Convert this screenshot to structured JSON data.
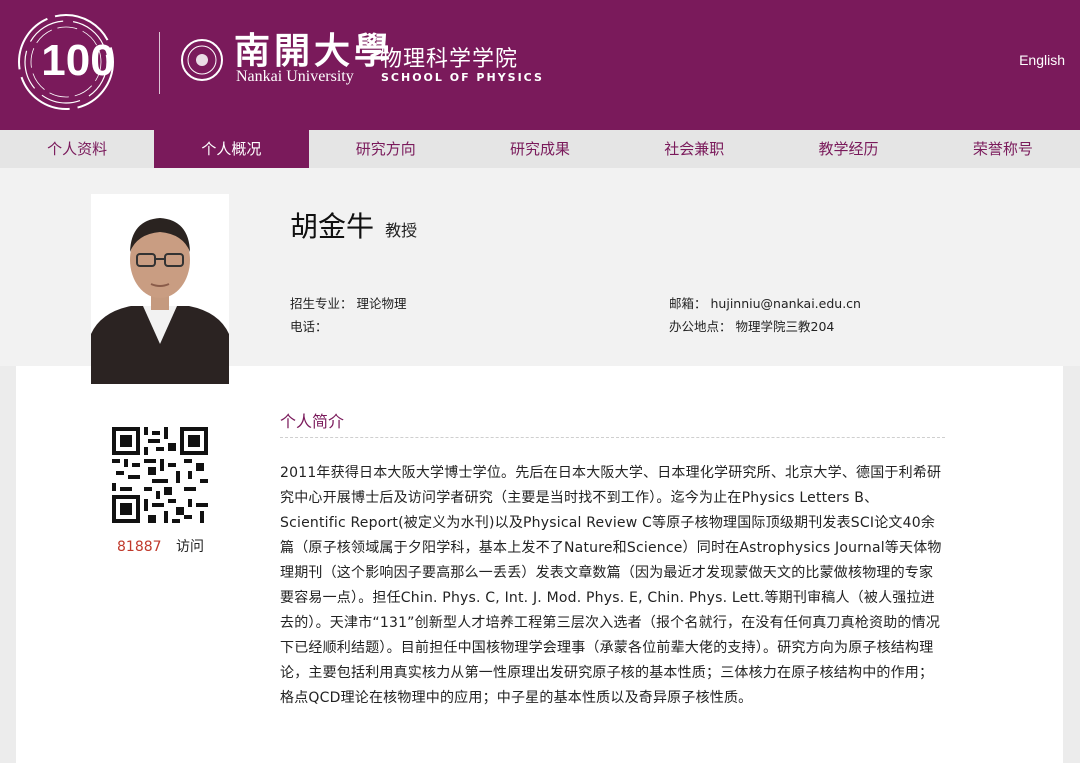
{
  "header": {
    "logo_number": "100",
    "university_cn": "南開大學",
    "university_en": "Nankai University",
    "school_cn": "物理科学学院",
    "school_en": "SCHOOL OF PHYSICS",
    "language_link": "English",
    "brand_color": "#7a1a5b"
  },
  "nav": {
    "items": [
      {
        "label": "个人资料",
        "active": false
      },
      {
        "label": "个人概况",
        "active": true
      },
      {
        "label": "研究方向",
        "active": false
      },
      {
        "label": "研究成果",
        "active": false
      },
      {
        "label": "社会兼职",
        "active": false
      },
      {
        "label": "教学经历",
        "active": false
      },
      {
        "label": "荣誉称号",
        "active": false
      }
    ]
  },
  "profile": {
    "name": "胡金牛",
    "title": "教授",
    "major_label": "招生专业：",
    "major_value": "理论物理",
    "phone_label": "电话：",
    "phone_value": "",
    "email_label": "邮箱：",
    "email_value": "hujinniu@nankai.edu.cn",
    "office_label": "办公地点：",
    "office_value": "物理学院三教204"
  },
  "stats": {
    "visit_count": "81887",
    "visit_label": "访问"
  },
  "bio": {
    "section_title": "个人简介",
    "text": "2011年获得日本大阪大学博士学位。先后在日本大阪大学、日本理化学研究所、北京大学、德国于利希研究中心开展博士后及访问学者研究（主要是当时找不到工作）。迄今为止在Physics Letters B、Scientific Report(被定义为水刊)以及Physical Review C等原子核物理国际顶级期刊发表SCI论文40余篇（原子核领域属于夕阳学科，基本上发不了Nature和Science）同时在Astrophysics Journal等天体物理期刊（这个影响因子要高那么一丢丢）发表文章数篇（因为最近才发现蒙做天文的比蒙做核物理的专家要容易一点）。担任Chin. Phys. C, Int. J. Mod. Phys. E, Chin. Phys. Lett.等期刊审稿人（被人强拉进去的）。天津市“131”创新型人才培养工程第三层次入选者（报个名就行，在没有任何真刀真枪资助的情况下已经顺利结题）。目前担任中国核物理学会理事（承蒙各位前辈大佬的支持）。研究方向为原子核结构理论，主要包括利用真实核力从第一性原理出发研究原子核的基本性质；三体核力在原子核结构中的作用；格点QCD理论在核物理中的应用；中子星的基本性质以及奇异原子核性质。"
  }
}
